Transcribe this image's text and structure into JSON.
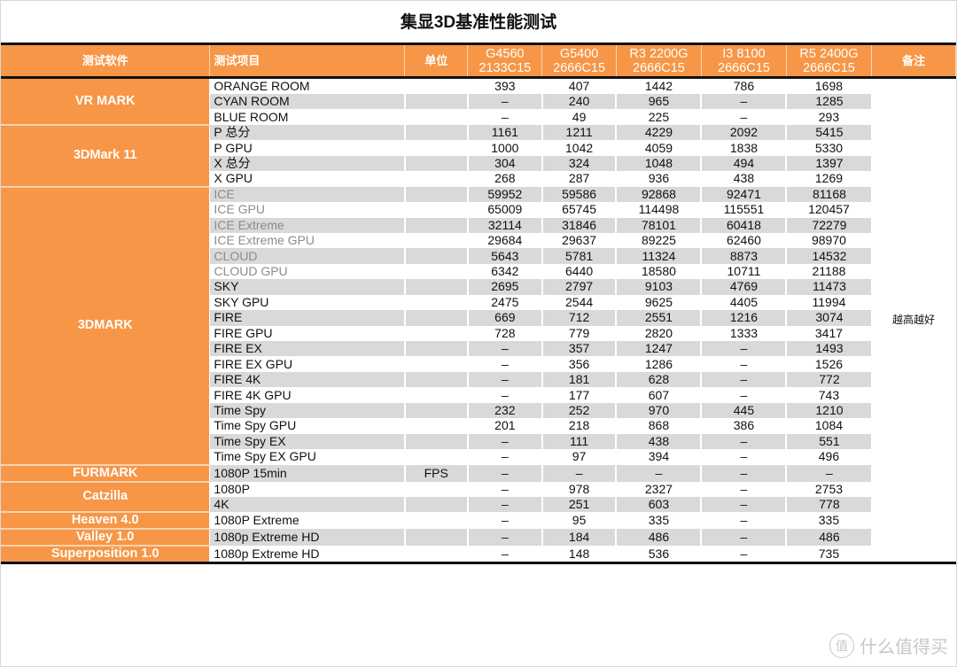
{
  "title": "集显3D基准性能测试",
  "header": {
    "software": "测试软件",
    "item": "测试项目",
    "unit": "单位",
    "cpus": [
      {
        "line1": "G4560",
        "line2": "2133C15"
      },
      {
        "line1": "G5400",
        "line2": "2666C15"
      },
      {
        "line1": "R3 2200G",
        "line2": "2666C15"
      },
      {
        "line1": "I3 8100",
        "line2": "2666C15"
      },
      {
        "line1": "R5 2400G",
        "line2": "2666C15"
      }
    ],
    "note": "备注"
  },
  "note_text": "越高越好",
  "groups": [
    {
      "software": "VR MARK",
      "rows": [
        {
          "item": "ORANGE ROOM",
          "unit": "",
          "values": [
            "393",
            "407",
            "1442",
            "786",
            "1698"
          ]
        },
        {
          "item": "CYAN ROOM",
          "unit": "",
          "values": [
            "–",
            "240",
            "965",
            "–",
            "1285"
          ]
        },
        {
          "item": "BLUE ROOM",
          "unit": "",
          "values": [
            "–",
            "49",
            "225",
            "–",
            "293"
          ]
        }
      ]
    },
    {
      "software": "3DMark 11",
      "rows": [
        {
          "item": "P 总分",
          "unit": "",
          "values": [
            "1161",
            "1211",
            "4229",
            "2092",
            "5415"
          ]
        },
        {
          "item": "P GPU",
          "unit": "",
          "values": [
            "1000",
            "1042",
            "4059",
            "1838",
            "5330"
          ]
        },
        {
          "item": "X 总分",
          "unit": "",
          "values": [
            "304",
            "324",
            "1048",
            "494",
            "1397"
          ]
        },
        {
          "item": "X GPU",
          "unit": "",
          "values": [
            "268",
            "287",
            "936",
            "438",
            "1269"
          ]
        }
      ]
    },
    {
      "software": "3DMARK",
      "rows": [
        {
          "item": "ICE",
          "unit": "",
          "grey": true,
          "values": [
            "59952",
            "59586",
            "92868",
            "92471",
            "81168"
          ]
        },
        {
          "item": "ICE GPU",
          "unit": "",
          "grey": true,
          "values": [
            "65009",
            "65745",
            "114498",
            "115551",
            "120457"
          ]
        },
        {
          "item": "ICE Extreme",
          "unit": "",
          "grey": true,
          "values": [
            "32114",
            "31846",
            "78101",
            "60418",
            "72279"
          ]
        },
        {
          "item": "ICE Extreme GPU",
          "unit": "",
          "grey": true,
          "values": [
            "29684",
            "29637",
            "89225",
            "62460",
            "98970"
          ]
        },
        {
          "item": "CLOUD",
          "unit": "",
          "grey": true,
          "values": [
            "5643",
            "5781",
            "11324",
            "8873",
            "14532"
          ]
        },
        {
          "item": "CLOUD GPU",
          "unit": "",
          "grey": true,
          "values": [
            "6342",
            "6440",
            "18580",
            "10711",
            "21188"
          ]
        },
        {
          "item": "SKY",
          "unit": "",
          "values": [
            "2695",
            "2797",
            "9103",
            "4769",
            "11473"
          ]
        },
        {
          "item": "SKY GPU",
          "unit": "",
          "values": [
            "2475",
            "2544",
            "9625",
            "4405",
            "11994"
          ]
        },
        {
          "item": "FIRE",
          "unit": "",
          "values": [
            "669",
            "712",
            "2551",
            "1216",
            "3074"
          ]
        },
        {
          "item": "FIRE GPU",
          "unit": "",
          "values": [
            "728",
            "779",
            "2820",
            "1333",
            "3417"
          ]
        },
        {
          "item": "FIRE EX",
          "unit": "",
          "values": [
            "–",
            "357",
            "1247",
            "–",
            "1493"
          ]
        },
        {
          "item": "FIRE EX GPU",
          "unit": "",
          "values": [
            "–",
            "356",
            "1286",
            "–",
            "1526"
          ]
        },
        {
          "item": "FIRE 4K",
          "unit": "",
          "values": [
            "–",
            "181",
            "628",
            "–",
            "772"
          ]
        },
        {
          "item": "FIRE 4K GPU",
          "unit": "",
          "values": [
            "–",
            "177",
            "607",
            "–",
            "743"
          ]
        },
        {
          "item": "Time Spy",
          "unit": "",
          "values": [
            "232",
            "252",
            "970",
            "445",
            "1210"
          ]
        },
        {
          "item": "Time Spy GPU",
          "unit": "",
          "values": [
            "201",
            "218",
            "868",
            "386",
            "1084"
          ]
        },
        {
          "item": "Time Spy EX",
          "unit": "",
          "values": [
            "–",
            "111",
            "438",
            "–",
            "551"
          ]
        },
        {
          "item": "Time Spy EX GPU",
          "unit": "",
          "values": [
            "–",
            "97",
            "394",
            "–",
            "496"
          ]
        }
      ]
    },
    {
      "software": "FURMARK",
      "rows": [
        {
          "item": "1080P 15min",
          "unit": "FPS",
          "values": [
            "–",
            "–",
            "–",
            "–",
            "–"
          ]
        }
      ]
    },
    {
      "software": "Catzilla",
      "rows": [
        {
          "item": "1080P",
          "unit": "",
          "values": [
            "–",
            "978",
            "2327",
            "–",
            "2753"
          ]
        },
        {
          "item": "4K",
          "unit": "",
          "values": [
            "–",
            "251",
            "603",
            "–",
            "778"
          ]
        }
      ]
    },
    {
      "software": "Heaven 4.0",
      "rows": [
        {
          "item": "1080P Extreme",
          "unit": "",
          "values": [
            "–",
            "95",
            "335",
            "–",
            "335"
          ]
        }
      ]
    },
    {
      "software": "Valley 1.0",
      "rows": [
        {
          "item": "1080p Extreme HD",
          "unit": "",
          "values": [
            "–",
            "184",
            "486",
            "–",
            "486"
          ]
        }
      ]
    },
    {
      "software": "Superposition 1.0",
      "rows": [
        {
          "item": "1080p Extreme HD",
          "unit": "",
          "values": [
            "–",
            "148",
            "536",
            "–",
            "735"
          ]
        }
      ]
    }
  ],
  "watermark": {
    "icon": "值",
    "text": "什么值得买"
  }
}
